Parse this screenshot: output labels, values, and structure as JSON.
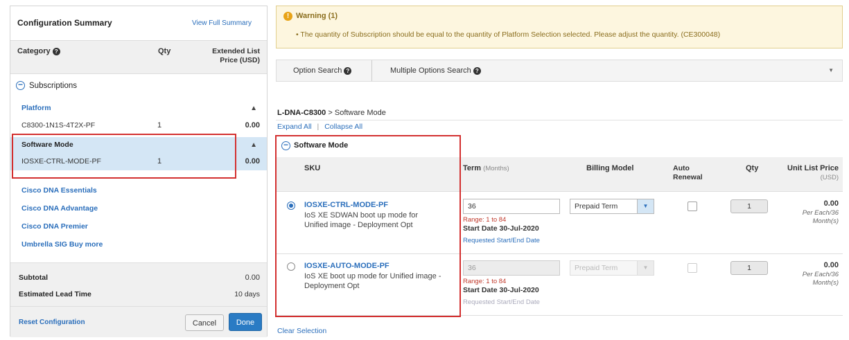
{
  "summary": {
    "title": "Configuration Summary",
    "view_full_link": "View Full Summary",
    "col_category": "Category",
    "col_qty": "Qty",
    "col_extended_price": "Extended List Price (USD)",
    "subscriptions_label": "Subscriptions",
    "platform_label": "Platform",
    "platform_sku": "C8300-1N1S-4T2X-PF",
    "platform_qty": "1",
    "platform_price": "0.00",
    "software_mode_label": "Software Mode",
    "software_mode_sku": "IOSXE-CTRL-MODE-PF",
    "software_mode_qty": "1",
    "software_mode_price": "0.00",
    "links": [
      "Cisco DNA Essentials",
      "Cisco DNA Advantage",
      "Cisco DNA Premier",
      "Umbrella SIG Buy more"
    ],
    "subtotal_label": "Subtotal",
    "subtotal_value": "0.00",
    "lead_time_label": "Estimated Lead Time",
    "lead_time_value": "10 days",
    "reset_link": "Reset Configuration",
    "cancel_button": "Cancel",
    "done_button": "Done"
  },
  "warning": {
    "title": "Warning (1)",
    "message": "• The quantity of Subscription should be equal to the quantity of Platform Selection selected. Please adjust the quantity. (CE300048)"
  },
  "search": {
    "option_search": "Option Search",
    "multiple_search": "Multiple Options Search"
  },
  "breadcrumb": {
    "parent": "L-DNA-C8300",
    "separator": ">",
    "current": "Software Mode"
  },
  "expand_all": "Expand All",
  "collapse_all": "Collapse All",
  "expand_separator": "|",
  "section_title": "Software Mode",
  "table": {
    "col_sku": "SKU",
    "col_term": "Term",
    "col_term_unit": "(Months)",
    "col_billing": "Billing Model",
    "col_auto_renewal": "Auto Renewal",
    "col_qty": "Qty",
    "col_unit_price": "Unit List Price",
    "col_unit_price_unit": "(USD)",
    "rows": [
      {
        "sku": "IOSXE-CTRL-MODE-PF",
        "desc": "IoS XE SDWAN boot up mode for Unified image - Deployment Opt",
        "term": "36",
        "range": "Range: 1 to 84",
        "start_date": "Start Date 30-Jul-2020",
        "req_link": "Requested Start/End Date",
        "billing": "Prepaid Term",
        "qty": "1",
        "price": "0.00",
        "price_sub": "Per Each/36 Month(s)"
      },
      {
        "sku": "IOSXE-AUTO-MODE-PF",
        "desc": "IoS XE boot up mode for Unified image - Deployment Opt",
        "term": "36",
        "range": "Range: 1 to 84",
        "start_date": "Start Date 30-Jul-2020",
        "req_link": "Requested Start/End Date",
        "billing": "Prepaid Term",
        "qty": "1",
        "price": "0.00",
        "price_sub": "Per Each/36 Month(s)"
      }
    ]
  },
  "clear_selection": "Clear Selection",
  "colors": {
    "link": "#2a6ebb",
    "highlight": "#d32f2f",
    "warning_bg": "#fdf6df",
    "selected_row": "#d4e6f5",
    "done_button": "#2a7bc4"
  }
}
